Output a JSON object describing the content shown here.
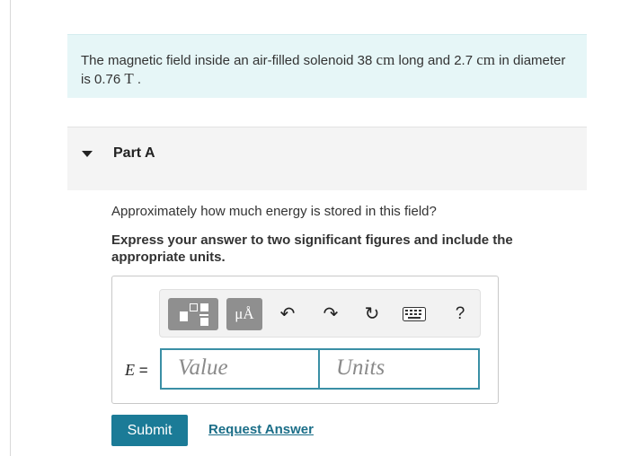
{
  "problem": {
    "text_1": "The magnetic field inside an air-filled solenoid 38 ",
    "unit_cm_1": "cm",
    "text_2": " long and 2.7 ",
    "unit_cm_2": "cm",
    "text_3": " in diameter is 0.76 ",
    "unit_T": "T",
    "text_4": " ."
  },
  "part": {
    "title": "Part A"
  },
  "question": {
    "prompt": "Approximately how much energy is stored in this field?",
    "instruction": "Express your answer to two significant figures and include the appropriate units."
  },
  "toolbar": {
    "units_button": "μÅ",
    "undo_glyph": "↶",
    "redo_glyph": "↷",
    "reset_glyph": "↻",
    "help_glyph": "?",
    "icons": [
      "templates-icon",
      "units-icon",
      "undo-icon",
      "redo-icon",
      "reset-icon",
      "keyboard-icon",
      "help-icon"
    ]
  },
  "answer": {
    "variable": "E",
    "equals": " =",
    "value_placeholder": "Value",
    "units_placeholder": "Units"
  },
  "actions": {
    "submit_label": "Submit",
    "request_answer_label": "Request Answer"
  },
  "colors": {
    "problem_bg": "#e6f6f7",
    "accent": "#1b7b97",
    "field_border": "#3a8fa5",
    "link": "#1b6e88"
  }
}
